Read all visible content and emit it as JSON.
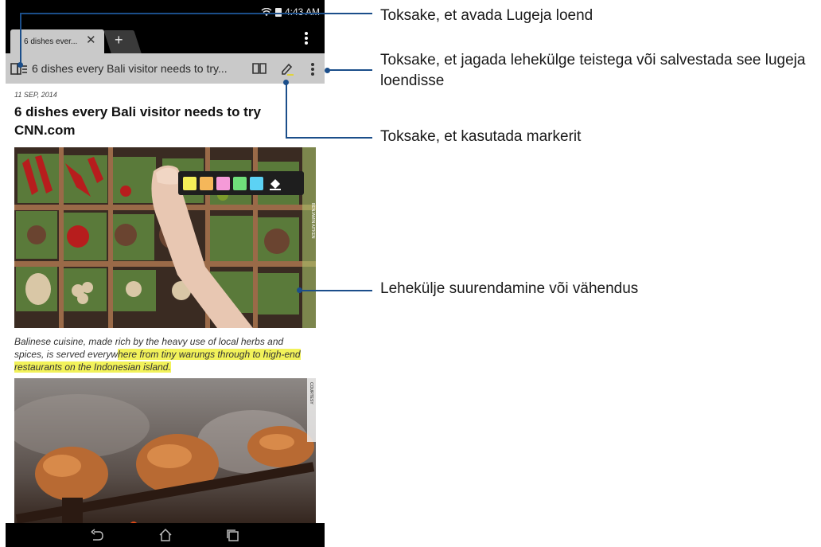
{
  "status": {
    "time": "4:43 AM"
  },
  "tab": {
    "title": "6 dishes ever...",
    "close": "✕",
    "new_tab": "+"
  },
  "urlbar": {
    "page_title": "6 dishes every Bali visitor needs to try..."
  },
  "article": {
    "date": "11 SEP, 2014",
    "title": "6 dishes every Bali visitor needs to try CNN.com",
    "caption_plain": "Balinese cuisine, made rich by the heavy use of local herbs and spices, is served everyw",
    "caption_highlight": "here from tiny warungs through to high-end restaurants on the Indonesian island.",
    "image_credit_1": "BENJAMIN AITKEN",
    "image_credit_2": "COURTESY"
  },
  "highlighter": {
    "colors": [
      "#f4ef58",
      "#f5b75a",
      "#f59ad8",
      "#6fe07a",
      "#5cd2f4"
    ]
  },
  "callouts": {
    "reading_list": "Toksake, et avada Lugeja loend",
    "share_save": "Toksake, et jagada lehekülge teistega või salvestada see lugeja loendisse",
    "highlighter": "Toksake, et kasutada markerit",
    "zoom": "Lehekülje suurendamine või vähendus"
  },
  "colors": {
    "accent": "#1b4e8a",
    "urlbar": "#c9c9c9",
    "highlight": "#f2f25a"
  }
}
